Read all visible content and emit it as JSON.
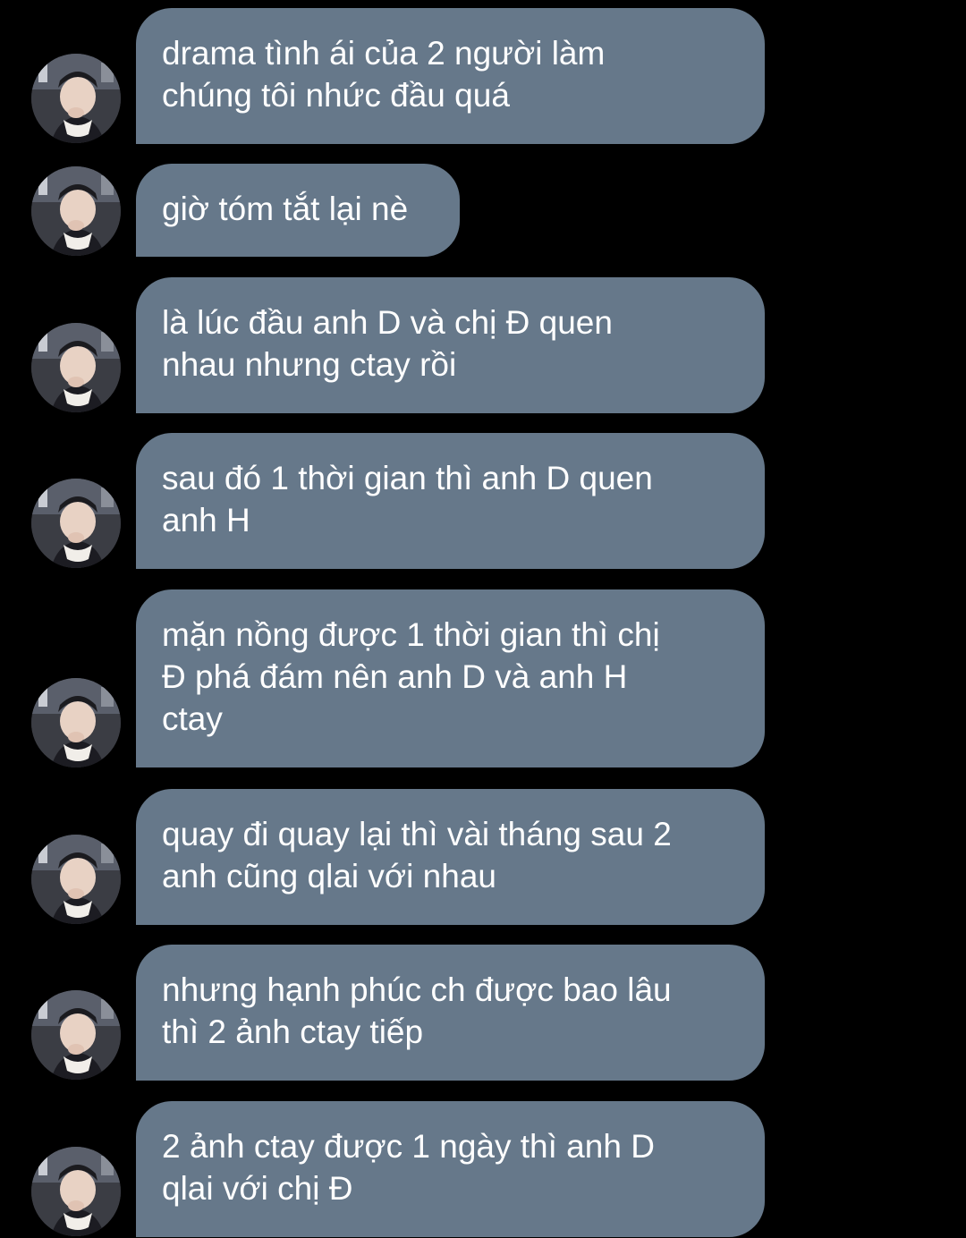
{
  "conversation": {
    "bubble_color": "#66788a",
    "text_color": "#ffffff",
    "background": "#000000",
    "messages": [
      {
        "text": "drama tình ái của 2 người làm\nchúng tôi nhức đầu quá"
      },
      {
        "text": "giờ tóm tắt lại nè"
      },
      {
        "text": "là lúc đầu anh D và chị Đ quen\nnhau nhưng ctay rồi"
      },
      {
        "text": "sau đó 1 thời gian thì anh D quen\nanh H"
      },
      {
        "text": "mặn nồng được 1 thời gian thì chị\nĐ phá đám nên anh D và anh H\nctay"
      },
      {
        "text": "quay đi quay lại thì vài tháng sau 2\nanh cũng qlai với nhau"
      },
      {
        "text": "nhưng hạnh phúc ch được bao lâu\nthì 2 ảnh ctay tiếp"
      },
      {
        "text": "2 ảnh ctay được 1 ngày thì anh D\nqlai với chị Đ"
      }
    ]
  }
}
